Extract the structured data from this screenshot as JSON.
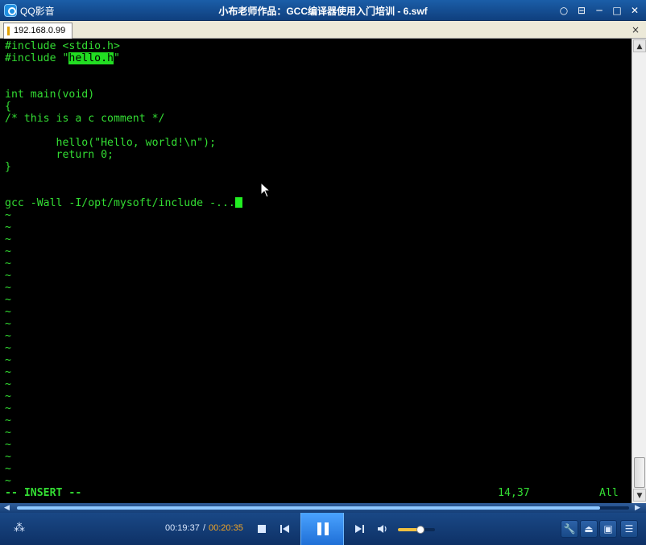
{
  "window": {
    "app_name": "QQ影音",
    "title": "小布老师作品：GCC编译器使用入门培训 - 6.swf",
    "buttons": {
      "chat": "○",
      "options": "⊟",
      "minimize": "─",
      "maximize": "□",
      "close": "✕"
    }
  },
  "terminal_tab": {
    "label": "192.168.0.99",
    "close": "×"
  },
  "terminal": {
    "lines": [
      "#include <stdio.h>",
      "#include \"",
      "",
      "",
      "int main(void)",
      "{",
      "/* this is a c comment */",
      "",
      "        hello(\"Hello, world!\\n\");",
      "        return 0;",
      "}",
      "",
      "",
      "gcc -Wall -I/opt/mysoft/include -..."
    ],
    "highlight": "hello.h",
    "quote_close": "\"",
    "tilde": "~",
    "tilde_count": 23,
    "status_mode": "-- INSERT --",
    "cursor_position": "14,37",
    "scroll_position": "All"
  },
  "player": {
    "current_time": "00:19:37",
    "separator": "/",
    "total_time": "00:20:35",
    "progress": 0.953,
    "volume": 0.6,
    "seek_left_arrow": "◀",
    "seek_right_arrow": "▶",
    "footprint": "⁂",
    "tools": {
      "settings": "🔧",
      "eject": "⏏",
      "screen": "▣",
      "playlist": "☰"
    }
  },
  "colors": {
    "terminal_text": "#33dd33",
    "terminal_bg": "#000000",
    "player_bg": "#1d4f8f",
    "time_total": "#f5a623"
  }
}
